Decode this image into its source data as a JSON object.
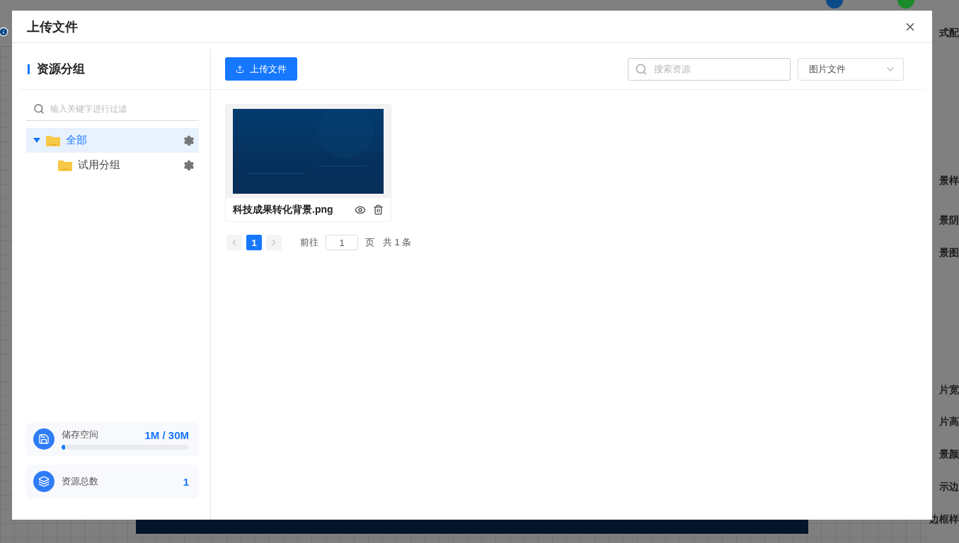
{
  "background": {
    "labels": [
      "式配",
      "景样",
      "景阴",
      "景图",
      "片宽",
      "片高",
      "景颜",
      "示边",
      "边框样"
    ]
  },
  "dialog": {
    "title": "上传文件",
    "sidebar": {
      "title": "资源分组",
      "filter": {
        "placeholder": "输入关键字进行过滤"
      },
      "tree": [
        {
          "label": "全部",
          "selected": true,
          "expanded": true,
          "children": [
            {
              "label": "试用分组",
              "selected": false
            }
          ]
        }
      ],
      "stats": [
        {
          "kind": "storage",
          "label": "储存空间",
          "value": "1M / 30M",
          "level": 0.03
        },
        {
          "kind": "count",
          "label": "资源总数",
          "value": "1"
        }
      ]
    },
    "toolbar": {
      "upload_button": "上传文件",
      "search": {
        "placeholder": "搜索资源"
      },
      "type_select": {
        "value": "图片文件"
      }
    },
    "files": [
      {
        "name": "科技成果转化背景.png",
        "kind": "picture"
      }
    ],
    "pagination": {
      "pages": [
        {
          "label": "1",
          "selected": true
        }
      ],
      "goto_label": "前往",
      "goto_value": "1",
      "page_unit": "页",
      "total": "共 1 条"
    }
  }
}
